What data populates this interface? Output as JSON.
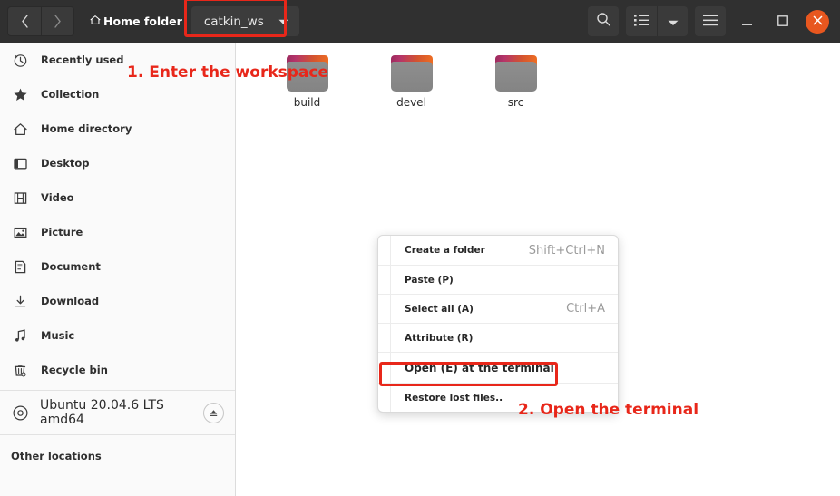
{
  "window": {
    "titlebar": {
      "back_icon": "chevron-left-icon",
      "forward_icon": "chevron-right-icon",
      "home_icon": "home-icon",
      "home_label": "Home folder",
      "current_crumb": "catkin_ws",
      "crumb_dropdown_icon": "chevron-down-icon",
      "search_icon": "search-icon",
      "list_view_icon": "list-view-icon",
      "view_dropdown_icon": "chevron-down-icon",
      "menu_icon": "hamburger-menu-icon",
      "minimize_icon": "minimize-icon",
      "maximize_icon": "maximize-icon",
      "close_icon": "close-icon"
    }
  },
  "sidebar": {
    "items": [
      {
        "label": "Recently used",
        "icon": "clock-icon"
      },
      {
        "label": "Collection",
        "icon": "star-icon"
      },
      {
        "label": "Home directory",
        "icon": "home-icon"
      },
      {
        "label": "Desktop",
        "icon": "desktop-icon"
      },
      {
        "label": "Video",
        "icon": "film-icon"
      },
      {
        "label": "Picture",
        "icon": "image-icon"
      },
      {
        "label": "Document",
        "icon": "document-icon"
      },
      {
        "label": "Download",
        "icon": "download-icon"
      },
      {
        "label": "Music",
        "icon": "music-note-icon"
      },
      {
        "label": "Recycle bin",
        "icon": "trash-icon"
      }
    ],
    "drive": {
      "label": "Ubuntu 20.04.6 LTS amd64",
      "icon": "disc-icon",
      "eject_icon": "eject-icon"
    },
    "other_locations": "Other locations"
  },
  "main": {
    "folders": [
      {
        "name": "build"
      },
      {
        "name": "devel"
      },
      {
        "name": "src"
      }
    ]
  },
  "context_menu": {
    "items": [
      {
        "label": "Create a folder",
        "accel": "Shift+Ctrl+N"
      },
      {
        "label": "Paste (P)",
        "accel": ""
      },
      {
        "label": "Select all (A)",
        "accel": "Ctrl+A"
      },
      {
        "label": "Attribute (R)",
        "accel": ""
      },
      {
        "label": "Open (E) at the terminal",
        "accel": ""
      },
      {
        "label": "Restore lost files..",
        "accel": ""
      }
    ]
  },
  "annotations": {
    "step1": "1. Enter the workspace",
    "step2": "2. Open the terminal",
    "color": "#e8271a"
  }
}
